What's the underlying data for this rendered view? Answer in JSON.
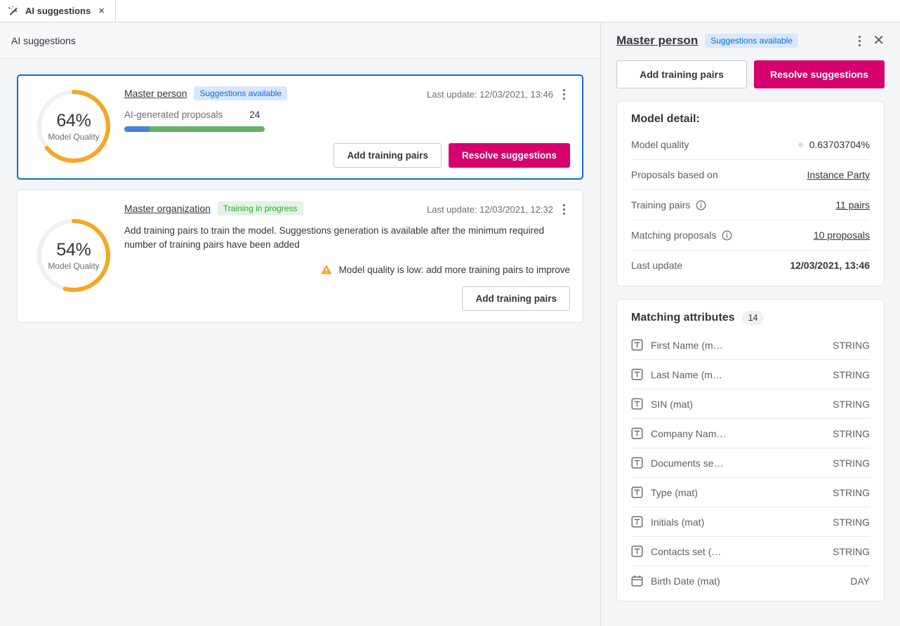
{
  "tab": {
    "label": "AI suggestions",
    "icon": "magic-wand-icon",
    "close": "×"
  },
  "left": {
    "header_title": "AI suggestions",
    "cards": [
      {
        "title": "Master person",
        "badge": "Suggestions available",
        "badge_kind": "info",
        "quality_pct": "64%",
        "quality_caption": "Model Quality",
        "quality_value": 64,
        "last_update_label": "Last update: 12/03/2021, 13:46",
        "proposals_label": "AI-generated proposals",
        "proposals_value": "24",
        "bar_blue_pct": 18,
        "bar_green_pct": 82,
        "buttons": [
          {
            "label": "Add training pairs",
            "kind": "secondary"
          },
          {
            "label": "Resolve suggestions",
            "kind": "primary"
          }
        ]
      },
      {
        "title": "Master organization",
        "badge": "Training in progress",
        "badge_kind": "ok",
        "quality_pct": "54%",
        "quality_caption": "Model Quality",
        "quality_value": 54,
        "last_update_label": "Last update: 12/03/2021, 12:32",
        "description": "Add training pairs to train the model. Suggestions generation is available after the minimum required number of training pairs have been added",
        "warning": "Model quality is low: add more training pairs to improve",
        "buttons": [
          {
            "label": "Add training pairs",
            "kind": "secondary"
          }
        ]
      }
    ]
  },
  "right": {
    "title": "Master person",
    "badge": "Suggestions available",
    "buttons": [
      {
        "label": "Add training pairs",
        "kind": "secondary"
      },
      {
        "label": "Resolve suggestions",
        "kind": "primary"
      }
    ],
    "model_detail": {
      "heading": "Model detail:",
      "rows": [
        {
          "key": "Model quality",
          "value": "0.63703704%",
          "style": "dot",
          "info": false
        },
        {
          "key": "Proposals based on",
          "value": "Instance Party",
          "style": "link",
          "info": false
        },
        {
          "key": "Training pairs",
          "value": "11  pairs",
          "style": "link",
          "info": true
        },
        {
          "key": "Matching proposals",
          "value": "10  proposals",
          "style": "link",
          "info": true
        },
        {
          "key": "Last update",
          "value": "12/03/2021, 13:46",
          "style": "bold",
          "info": false
        }
      ]
    },
    "matching_attributes": {
      "heading": "Matching attributes",
      "count": "14",
      "rows": [
        {
          "name": "First Name (m…",
          "type": "STRING",
          "icon": "text-type-icon"
        },
        {
          "name": "Last Name (m…",
          "type": "STRING",
          "icon": "text-type-icon"
        },
        {
          "name": "SIN (mat)",
          "type": "STRING",
          "icon": "text-type-icon"
        },
        {
          "name": "Company Nam…",
          "type": "STRING",
          "icon": "text-type-icon"
        },
        {
          "name": "Documents se…",
          "type": "STRING",
          "icon": "text-type-icon"
        },
        {
          "name": "Type (mat)",
          "type": "STRING",
          "icon": "text-type-icon"
        },
        {
          "name": "Initials (mat)",
          "type": "STRING",
          "icon": "text-type-icon"
        },
        {
          "name": "Contacts set (…",
          "type": "STRING",
          "icon": "text-type-icon"
        },
        {
          "name": "Birth Date (mat)",
          "type": "DAY",
          "icon": "calendar-icon"
        }
      ]
    }
  },
  "colors": {
    "accent_blue": "#0a6ed1",
    "primary_magenta": "#d6006e",
    "donut_orange": "#f5a623",
    "bar_blue": "#4a7fdc",
    "bar_green": "#68b168",
    "badge_ok_text": "#35a035",
    "warning_amber": "#f5a623"
  }
}
